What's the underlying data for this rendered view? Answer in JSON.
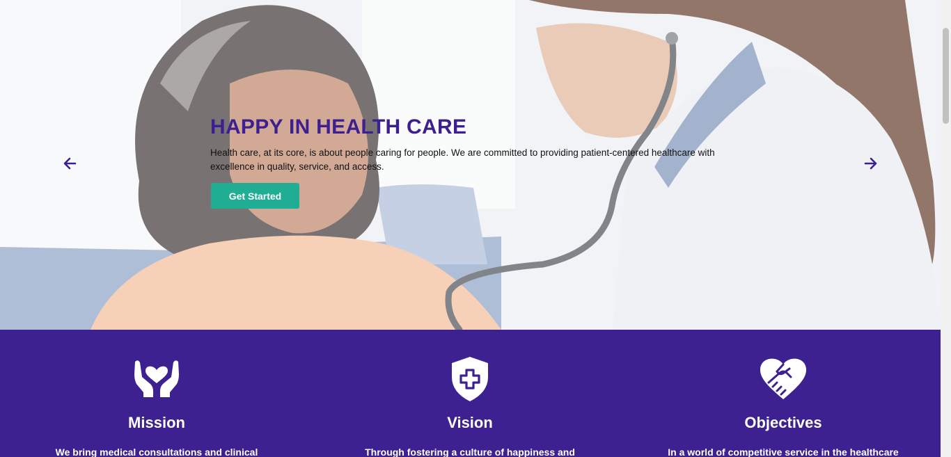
{
  "hero": {
    "title": "HAPPY IN HEALTH CARE",
    "description": "Health care, at its core, is about people caring for people. We are committed to providing patient-centered healthcare with excellence in quality, service, and access.",
    "cta_label": "Get Started",
    "prev_icon": "arrow-left-icon",
    "next_icon": "arrow-right-icon"
  },
  "features": [
    {
      "icon": "hands-heart-icon",
      "title": "Mission",
      "text": "We bring medical consultations and clinical"
    },
    {
      "icon": "shield-cross-icon",
      "title": "Vision",
      "text": "Through fostering a culture of happiness and"
    },
    {
      "icon": "handshake-heart-icon",
      "title": "Objectives",
      "text": "In a world of competitive service in the healthcare"
    }
  ],
  "colors": {
    "brand_purple": "#3e2191",
    "title_purple": "#3d1f8f",
    "accent_teal": "#1fae93"
  }
}
